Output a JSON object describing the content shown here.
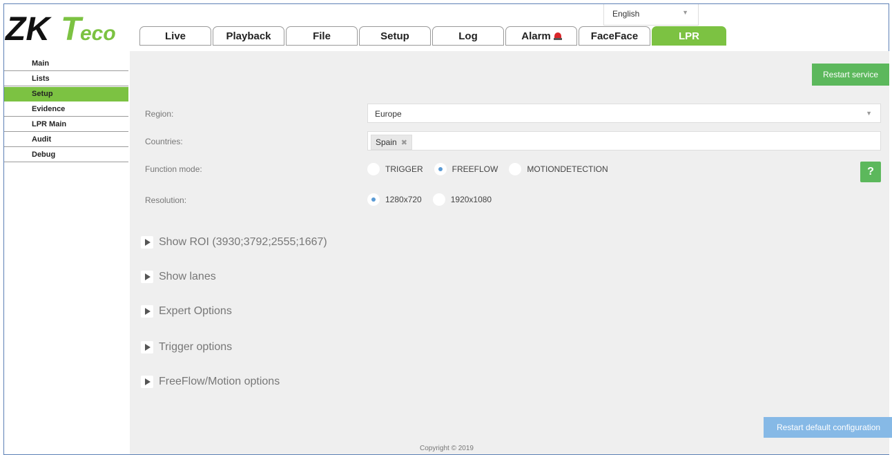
{
  "brand": {
    "logo_text": "ZKTeco"
  },
  "language": {
    "selected": "English"
  },
  "tabs": [
    {
      "label": "Live"
    },
    {
      "label": "Playback"
    },
    {
      "label": "File"
    },
    {
      "label": "Setup"
    },
    {
      "label": "Log"
    },
    {
      "label": "Alarm"
    },
    {
      "label": "FaceFace"
    },
    {
      "label": "LPR",
      "active": true
    }
  ],
  "sidebar": {
    "items": [
      {
        "label": "Main"
      },
      {
        "label": "Lists"
      },
      {
        "label": "Setup",
        "active": true
      },
      {
        "label": "Evidence"
      },
      {
        "label": "LPR Main"
      },
      {
        "label": "Audit"
      },
      {
        "label": "Debug"
      }
    ]
  },
  "main": {
    "restart_service": "Restart service",
    "region": {
      "label": "Region:",
      "value": "Europe"
    },
    "countries": {
      "label": "Countries:",
      "chips": [
        "Spain"
      ]
    },
    "function_mode": {
      "label": "Function mode:",
      "options": [
        "TRIGGER",
        "FREEFLOW",
        "MOTIONDETECTION"
      ],
      "selected": "FREEFLOW"
    },
    "resolution": {
      "label": "Resolution:",
      "options": [
        "1280x720",
        "1920x1080"
      ],
      "selected": "1280x720"
    },
    "help_label": "?",
    "sections": [
      "Show ROI (3930;3792;2555;1667)",
      "Show lanes",
      "Expert Options",
      "Trigger options",
      "FreeFlow/Motion options"
    ],
    "restart_default": "Restart default configuration",
    "copyright": "Copyright © 2019"
  },
  "colors": {
    "accent_green": "#7cc242",
    "button_green": "#5cb85c",
    "button_blue": "#86b9e6",
    "radio_dot": "#5b9bd5"
  }
}
